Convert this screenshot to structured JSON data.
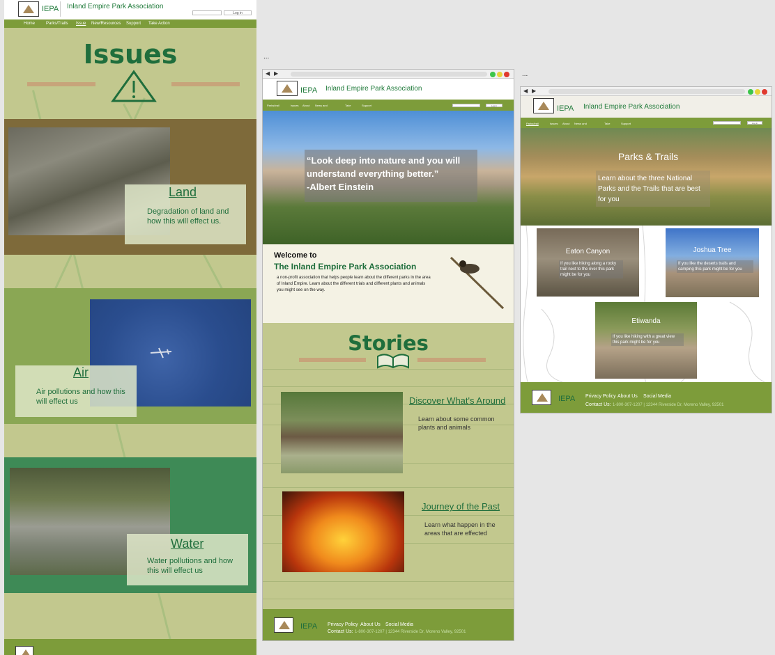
{
  "brand": {
    "logo_text": "IEPA",
    "org_name": "Inland Empire Park Association"
  },
  "nav_full": {
    "items": [
      "Home",
      "Parks/Trails",
      "Issue",
      "New/Resources",
      "Support",
      "Take Action"
    ],
    "login": "Log in"
  },
  "nav_small": {
    "items": [
      "Parks/trail",
      "Issues",
      "About",
      "News and",
      "Take",
      "Support"
    ],
    "login": "Log in"
  },
  "issues": {
    "title": "Issues",
    "land": {
      "title": "Land",
      "text": "Degradation of land and how this will effect us."
    },
    "air": {
      "title": "Air",
      "text": "Air pollutions and how this will effect us"
    },
    "water": {
      "title": "Water",
      "text": "Water pollutions and how this will effect us"
    }
  },
  "home": {
    "quote": "“Look deep into nature and you will understand everything better.”",
    "quote_author": "-Albert Einstein",
    "welcome_to": "Welcome to",
    "welcome_title": "The Inland Empire Park Association",
    "welcome_text": "a non-profit association that helps people learn about the different parks in the area of Inland Empire. Learn about the different trials and different plants and animals you might see on the way.",
    "stories_title": "Stories",
    "story1": {
      "title": "Discover What's Around",
      "text": "Learn about some common plants and animals"
    },
    "story2": {
      "title": "Journey of the Past",
      "text": "Learn what happen in the areas that are effected"
    }
  },
  "parks": {
    "hero_title": "Parks & Trails",
    "hero_text": "Learn about the three National Parks and the Trails that are best for you",
    "trails": [
      {
        "title": "Eaton Canyon",
        "text": "If you like hiking along a rocky trail next to the river this park might be for you"
      },
      {
        "title": "Joshua Tree",
        "text": "If you like the deserts trails and camping this park might be for you"
      },
      {
        "title": "Etiwanda",
        "text": "If you like hiking with a great view this park might be for you"
      }
    ]
  },
  "footer": {
    "links": [
      "Privacy Policy",
      "About Us",
      "Social Media"
    ],
    "contact_label": "Contact Us:",
    "contact_value": "1-800-307-1207 | 12344 Riverside Dr, Moreno Valley, 92501"
  },
  "ellipsis": "...",
  "colors": {
    "primary_green": "#1f6e3c",
    "nav_green": "#7d9c3a",
    "bg_sage": "#c2c88e",
    "tan": "#c7a47a"
  }
}
